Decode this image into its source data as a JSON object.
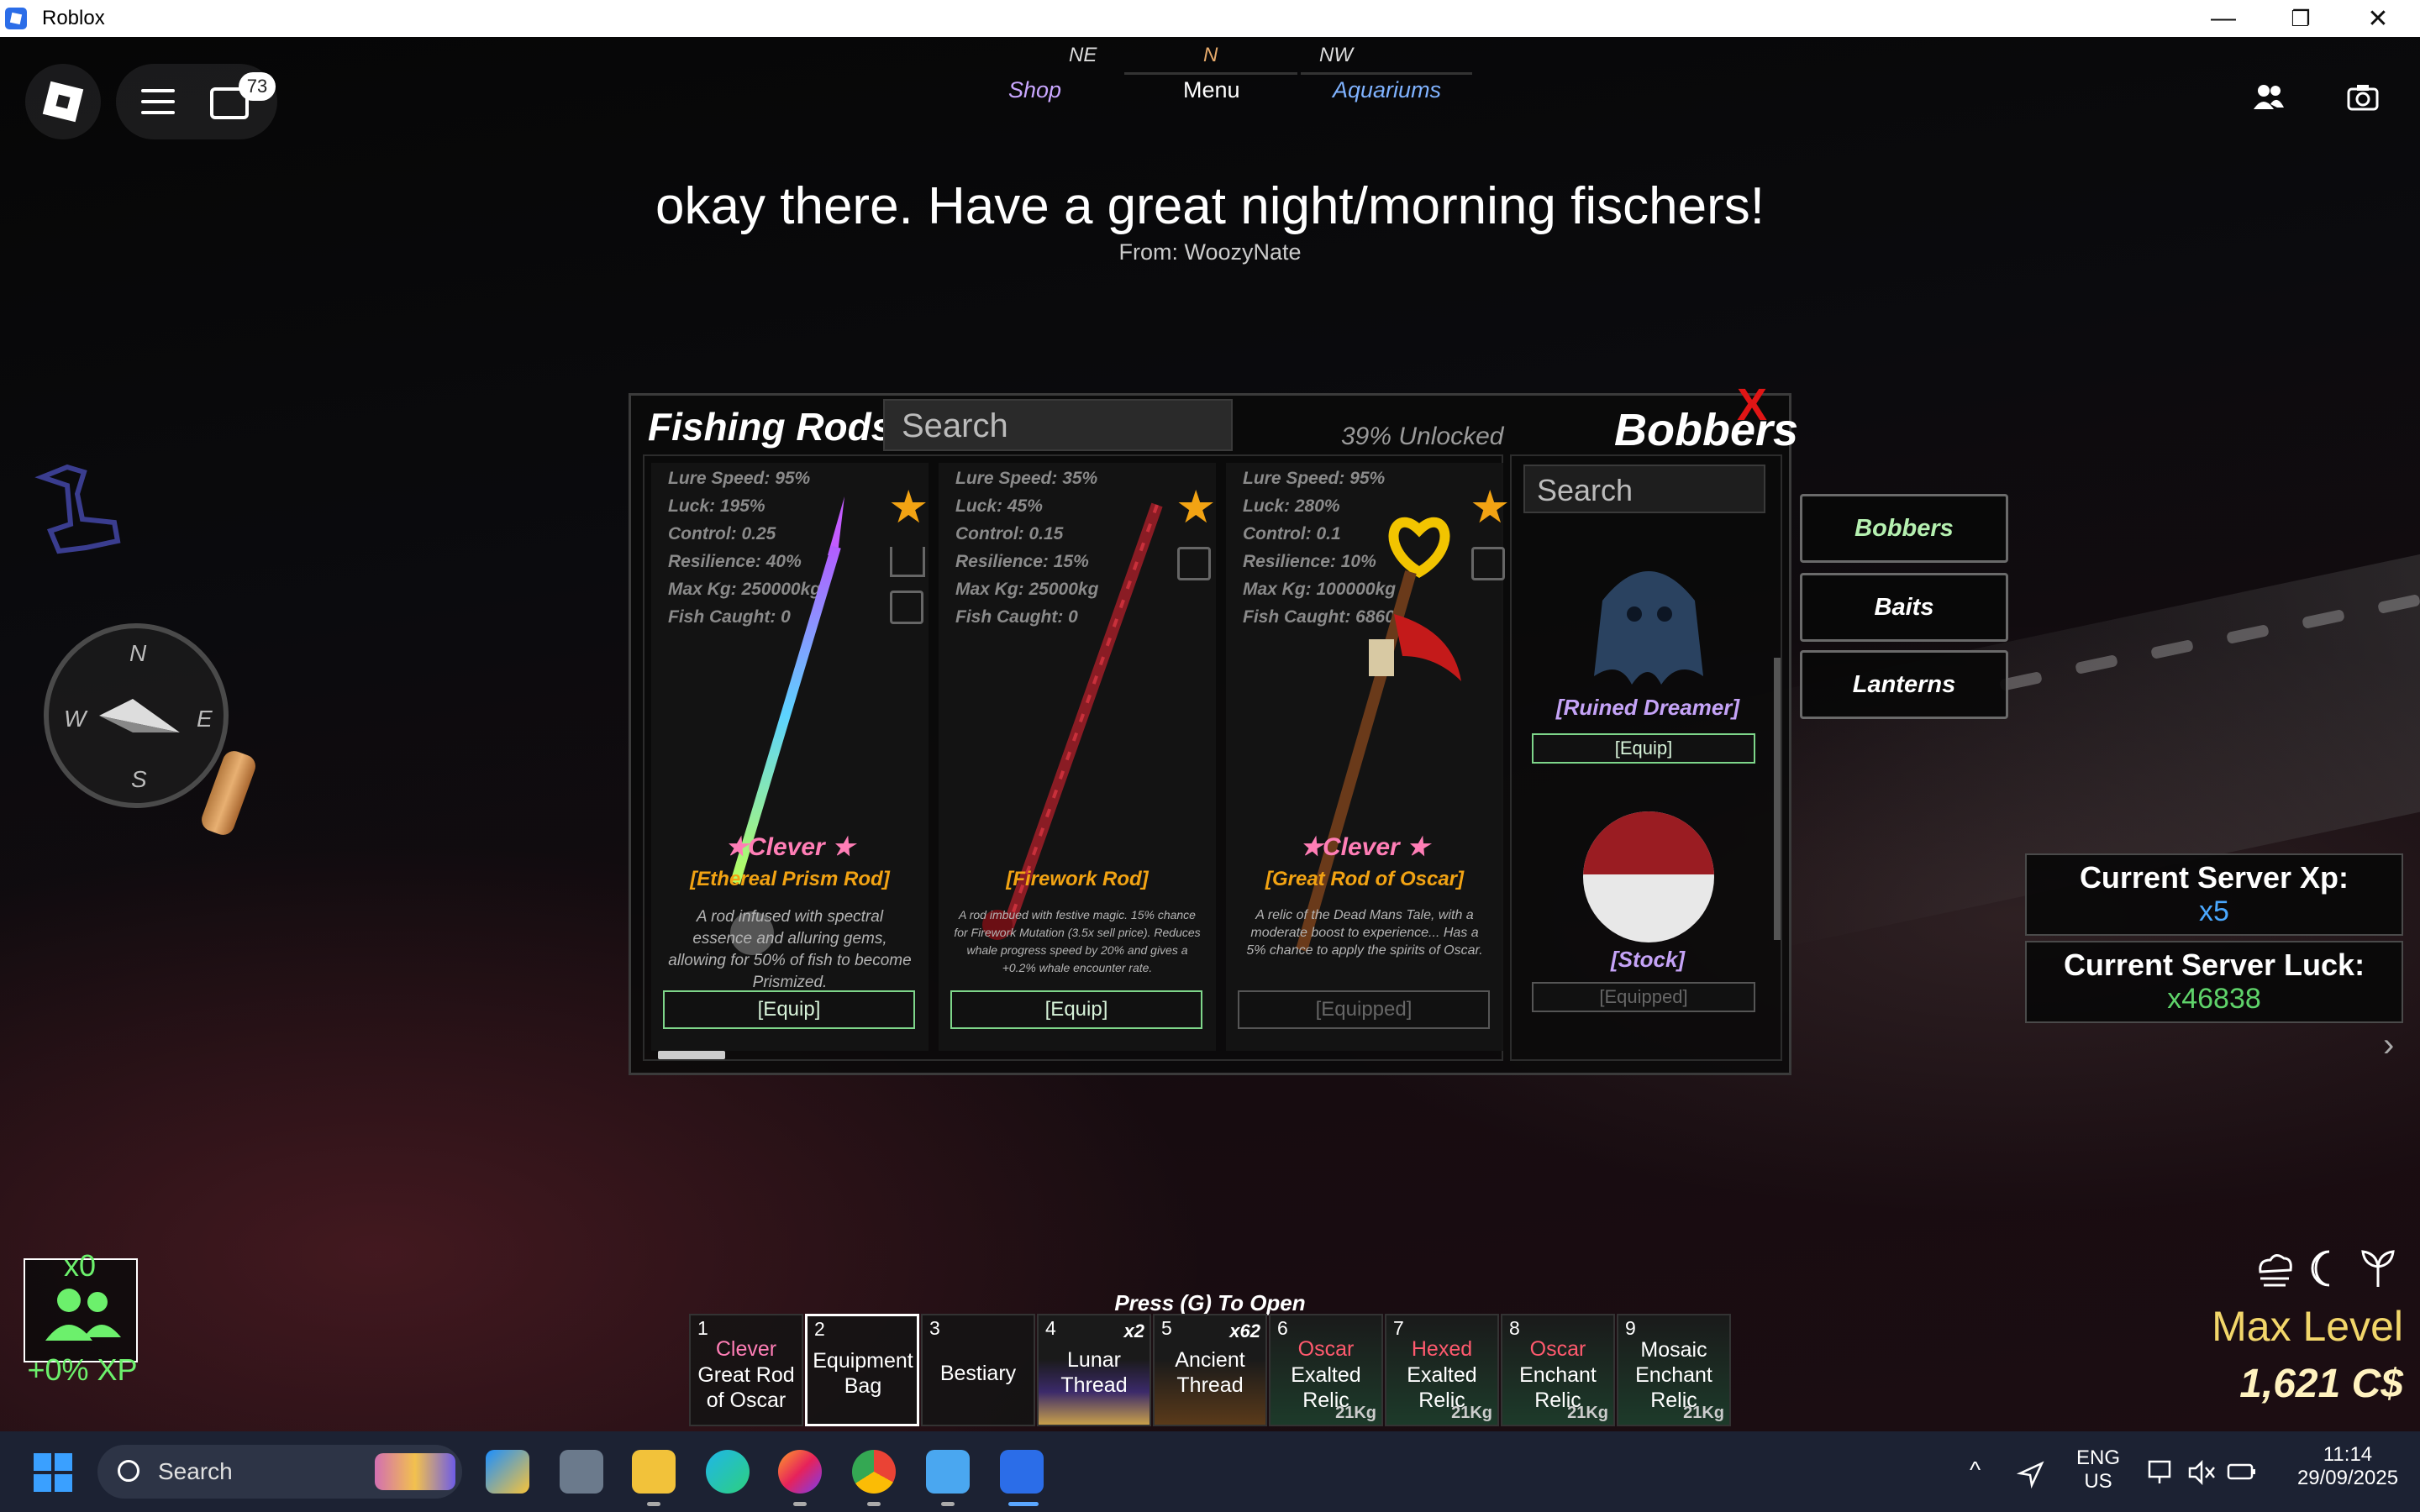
{
  "window": {
    "title": "Roblox",
    "minimize": "—",
    "restore": "❐",
    "close": "✕"
  },
  "topbar": {
    "chat_badge": "73",
    "compass": {
      "ne": "NE",
      "n": "N",
      "nw": "NW"
    },
    "nav": {
      "shop": "Shop",
      "menu": "Menu",
      "aquariums": "Aquariums"
    }
  },
  "announcement": {
    "message": "okay there. Have a great night/morning fischers!",
    "from": "From: WoozyNate"
  },
  "compass": {
    "n": "N",
    "s": "S",
    "e": "E",
    "w": "W"
  },
  "inventory": {
    "title": "Fishing Rods",
    "search_placeholder": "Search",
    "unlocked": "39% Unlocked",
    "bobbers_title": "Bobbers",
    "close": "X",
    "rods": [
      {
        "stats": [
          "Lure Speed: 95%",
          "Luck: 195%",
          "Control: 0.25",
          "Resilience: 40%",
          "Max Kg: 250000kg",
          "Fish Caught: 0"
        ],
        "mutation": "★Clever ★",
        "name": "[Ethereal Prism Rod]",
        "description": "A rod infused with spectral essence and alluring gems, allowing for 50% of fish to become Prismized.",
        "button": "[Equip]"
      },
      {
        "stats": [
          "Lure Speed: 35%",
          "Luck: 45%",
          "Control: 0.15",
          "Resilience: 15%",
          "Max Kg: 25000kg",
          "Fish Caught: 0"
        ],
        "mutation": "",
        "name": "[Firework Rod]",
        "description": "A rod imbued with festive magic. 15% chance for Firework Mutation (3.5x sell price). Reduces whale progress speed by 20% and gives a +0.2% whale encounter rate.",
        "button": "[Equip]"
      },
      {
        "stats": [
          "Lure Speed: 95%",
          "Luck: 280%",
          "Control: 0.1",
          "Resilience: 10%",
          "Max Kg: 100000kg",
          "Fish Caught: 6860"
        ],
        "mutation": "★Clever ★",
        "name": "[Great Rod of Oscar]",
        "description": "A relic of the Dead Mans Tale, with a moderate boost to experience... Has a 5% chance to apply the spirits of Oscar.",
        "button": "[Equipped]"
      }
    ],
    "bobber_search_placeholder": "Search",
    "bobbers": [
      {
        "name": "[Ruined Dreamer]",
        "button": "[Equip]"
      },
      {
        "name": "[Stock]",
        "button": "[Equipped]"
      }
    ]
  },
  "side_tabs": [
    "Bobbers",
    "Baits",
    "Lanterns"
  ],
  "server": {
    "xp_label": "Current Server Xp:",
    "xp_value": "x5",
    "luck_label": "Current Server Luck:",
    "luck_value": "x46838"
  },
  "hotbar": {
    "hint": "Press (G) To Open",
    "slots": [
      {
        "num": "1",
        "mutation": "Clever",
        "label": "Great Rod of Oscar",
        "qty": "",
        "kg": ""
      },
      {
        "num": "2",
        "mutation": "",
        "label": "Equipment Bag",
        "qty": "",
        "kg": ""
      },
      {
        "num": "3",
        "mutation": "",
        "label": "Bestiary",
        "qty": "",
        "kg": ""
      },
      {
        "num": "4",
        "mutation": "",
        "label": "Lunar Thread",
        "qty": "x2",
        "kg": ""
      },
      {
        "num": "5",
        "mutation": "",
        "label": "Ancient Thread",
        "qty": "x62",
        "kg": ""
      },
      {
        "num": "6",
        "mutation": "Oscar",
        "label": "Exalted Relic",
        "qty": "",
        "kg": "21Kg"
      },
      {
        "num": "7",
        "mutation": "Hexed",
        "label": "Exalted Relic",
        "qty": "",
        "kg": "21Kg"
      },
      {
        "num": "8",
        "mutation": "Oscar",
        "label": "Enchant Relic",
        "qty": "",
        "kg": "21Kg"
      },
      {
        "num": "9",
        "mutation": "",
        "label": "Mosaic Enchant Relic",
        "qty": "",
        "kg": "21Kg"
      }
    ]
  },
  "party": {
    "count": "x0",
    "xp": "+0% XP"
  },
  "player": {
    "level": "Max Level",
    "cash": "1,621 C$"
  },
  "taskbar": {
    "search": "Search",
    "lang_1": "ENG",
    "lang_2": "US",
    "time": "11:14",
    "date": "29/09/2025"
  }
}
